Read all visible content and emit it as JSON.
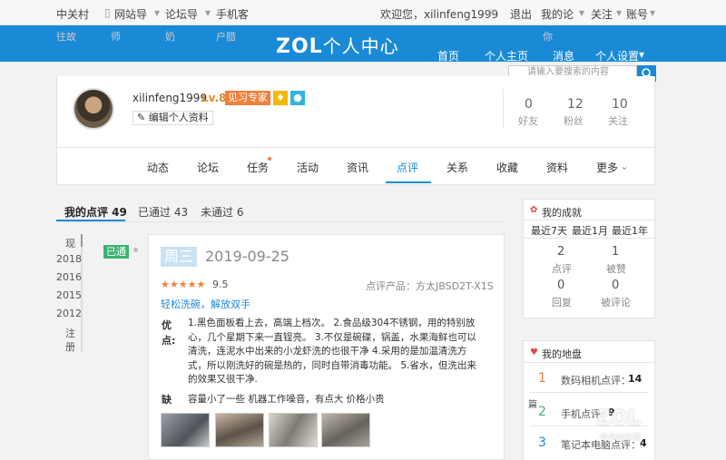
{
  "topbar": {
    "left_links": [
      "中关村",
      "网站导",
      "论坛导",
      "手机客"
    ],
    "welcome": "欢迎您，xilinfeng1999",
    "logout": "退出",
    "my_forum": "我的论",
    "follow": "关注",
    "account": "账号"
  },
  "header": {
    "logo_zol": "ZOL",
    "logo_title": "个人中心",
    "nav": [
      "首页",
      "个人主页",
      "消息",
      "个人设置"
    ],
    "search_placeholder": "请输入要搜索的内容",
    "faded_left": [
      "往故",
      "师",
      "奶",
      "户腊"
    ],
    "faded_right": "你"
  },
  "profile": {
    "username": "xilinfeng1999",
    "level": "Lv.8",
    "title_badge": "见习专家",
    "edit_label": "编辑个人资料",
    "stats": [
      {
        "value": "0",
        "label": "好友"
      },
      {
        "value": "12",
        "label": "粉丝"
      },
      {
        "value": "10",
        "label": "关注"
      }
    ]
  },
  "profile_tabs": [
    "动态",
    "论坛",
    "任务",
    "活动",
    "资讯",
    "点评",
    "关系",
    "收藏",
    "资料",
    "更多"
  ],
  "review_tabs": [
    {
      "label": "我的点评 49"
    },
    {
      "label": "已通过 43"
    },
    {
      "label": "未通过 6"
    }
  ],
  "timeline": [
    "现",
    "2018",
    "2016",
    "2015",
    "2012",
    "注",
    "册"
  ],
  "status_tag": "已通",
  "review": {
    "weekday": "周三",
    "date": "2019-09-25",
    "stars": "★★★★★",
    "score": "9.5",
    "product": "点评产品：方太JBSD2T-X1S",
    "title": "轻松洗碗，解放双手",
    "pros_label": "优点:",
    "pros_lines": [
      "1.黑色面板看上去，高端上档次。 2.食品级304不锈钢，用的特别放",
      "心，几个星期下来一直锃亮。 3.不仅是碗碟，锅盖，水果海鲜也可以",
      "清洗，连泥水中出来的小龙虾洗的也很干净 4.采用的是加温清洗方",
      "式，所以刚洗好的碗是热的，同时自带消毒功能。 5.省水，但洗出来",
      "的效果又很干净."
    ],
    "cons_label": "缺",
    "cons_text": "容量小了一些 机器工作噪音，有点大 价格小贵"
  },
  "achievements": {
    "title": "我的成就",
    "tabs": [
      "最近7天",
      "最近1月",
      "最近1年"
    ],
    "items": [
      {
        "value": "2",
        "label": "点评"
      },
      {
        "value": "1",
        "label": "被赞"
      },
      {
        "value": "0",
        "label": "回复"
      },
      {
        "value": "0",
        "label": "被评论"
      }
    ]
  },
  "territory": {
    "title": "我的地盘",
    "items": [
      {
        "rank": "1",
        "label": "数码相机点评：",
        "count": "14"
      },
      {
        "rank": "2",
        "label": "手机点评：",
        "count": "9"
      },
      {
        "rank": "3",
        "label": "笔记本电脑点评：",
        "count": "4"
      }
    ],
    "side_char": "篇"
  },
  "watermark": {
    "zol": "ZOL",
    "sub": "中关村在线"
  },
  "colors": {
    "brand_blue": "#1b8ad6",
    "star": "#f0803c",
    "status_green": "#3cb371",
    "badge_orange": "#f0803c",
    "badge_yellow": "#f5b700",
    "badge_cyan": "#31b4e0",
    "date_blue_bg": "#c8e2f5"
  }
}
